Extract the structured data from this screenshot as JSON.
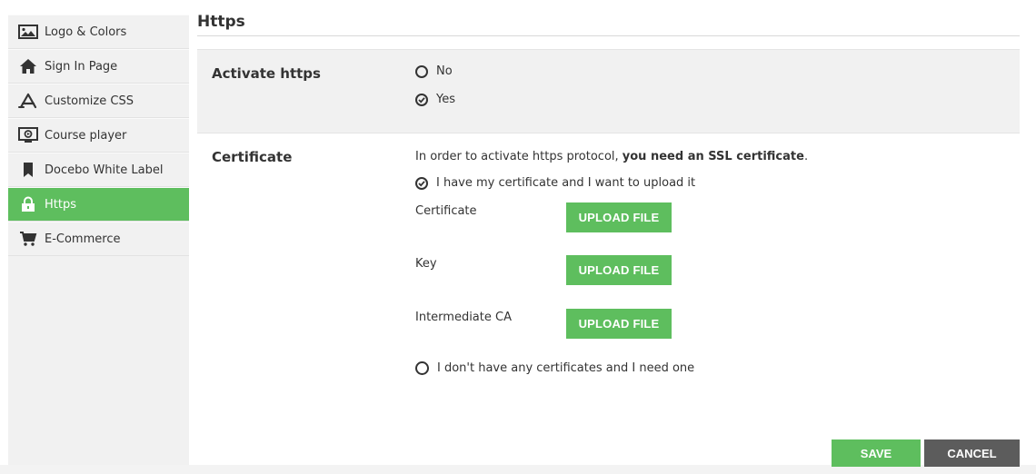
{
  "sidebar": {
    "items": [
      {
        "label": "Logo & Colors",
        "icon": "image-icon"
      },
      {
        "label": "Sign In Page",
        "icon": "home-icon"
      },
      {
        "label": "Customize CSS",
        "icon": "app-store-icon"
      },
      {
        "label": "Course player",
        "icon": "course-player-icon"
      },
      {
        "label": "Docebo White Label",
        "icon": "bookmark-icon"
      },
      {
        "label": "Https",
        "icon": "lock-icon",
        "active": true
      },
      {
        "label": "E-Commerce",
        "icon": "cart-icon"
      }
    ]
  },
  "page": {
    "title": "Https"
  },
  "activate": {
    "label": "Activate https",
    "options": [
      {
        "label": "No",
        "checked": false
      },
      {
        "label": "Yes",
        "checked": true
      }
    ]
  },
  "certificate": {
    "label": "Certificate",
    "intro_prefix": "In order to activate https protocol, ",
    "intro_bold": "you need an SSL certificate",
    "intro_suffix": ".",
    "option_have": "I have my certificate and I want to upload it",
    "option_need": "I don't have any certificates and I need one",
    "fields": [
      {
        "label": "Certificate",
        "button": "UPLOAD FILE"
      },
      {
        "label": "Key",
        "button": "UPLOAD FILE"
      },
      {
        "label": "Intermediate CA",
        "button": "UPLOAD FILE"
      }
    ]
  },
  "footer": {
    "save": "SAVE",
    "cancel": "CANCEL"
  },
  "colors": {
    "accent": "#5ebe5e",
    "cancel": "#5c5c5c",
    "panel": "#f1f1f1"
  }
}
